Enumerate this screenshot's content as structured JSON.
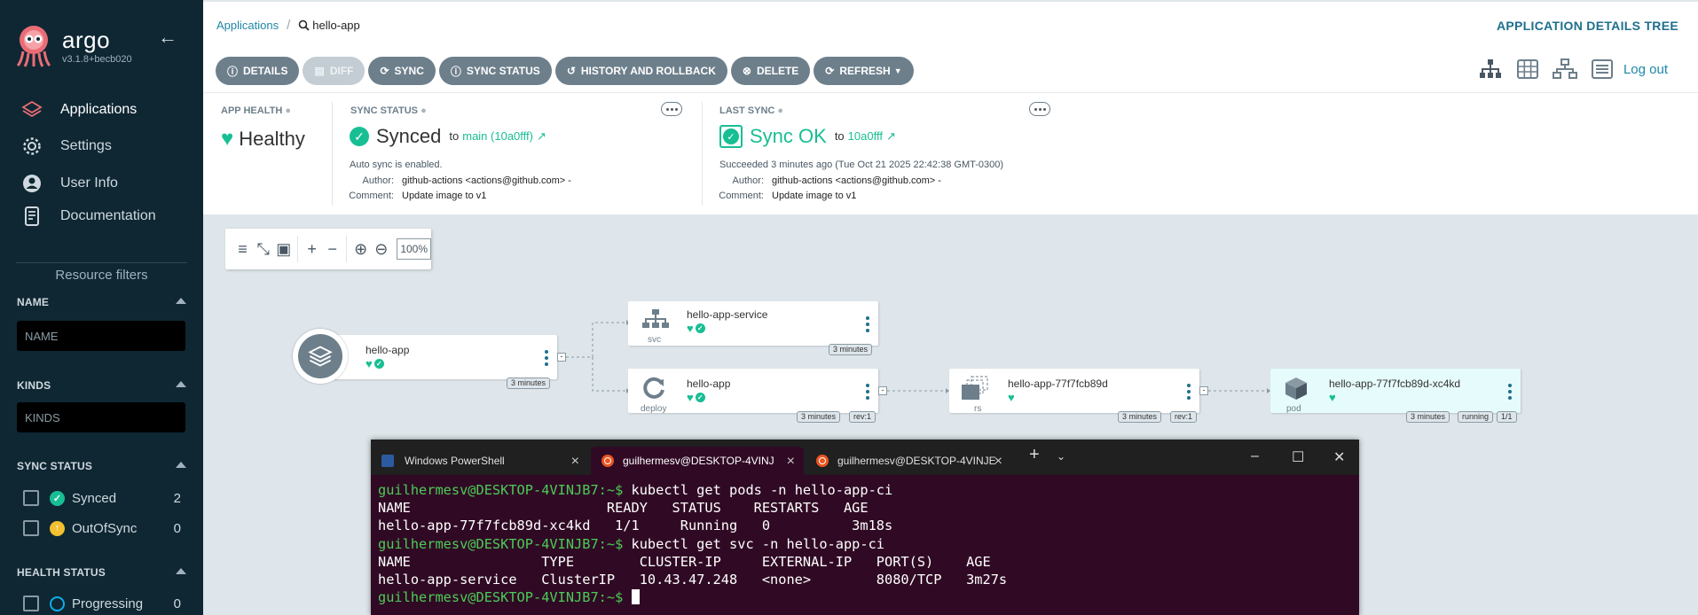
{
  "sidebar": {
    "logo_name": "argo",
    "version": "v3.1.8+becb020",
    "nav": [
      {
        "label": "Applications",
        "icon": "layers-icon"
      },
      {
        "label": "Settings",
        "icon": "gear-icon"
      },
      {
        "label": "User Info",
        "icon": "user-icon"
      },
      {
        "label": "Documentation",
        "icon": "docs-icon"
      }
    ],
    "resource_filters_label": "Resource filters",
    "filters": {
      "name_title": "NAME",
      "name_placeholder": "NAME",
      "kinds_title": "KINDS",
      "kinds_placeholder": "KINDS",
      "sync_status_title": "SYNC STATUS",
      "sync_status_options": [
        {
          "label": "Synced",
          "count": "2"
        },
        {
          "label": "OutOfSync",
          "count": "0"
        }
      ],
      "health_status_title": "HEALTH STATUS",
      "health_status_options": [
        {
          "label": "Progressing",
          "count": "0"
        }
      ]
    }
  },
  "header": {
    "breadcrumb_root": "Applications",
    "breadcrumb_current": "hello-app",
    "title": "APPLICATION DETAILS TREE",
    "logout": "Log out"
  },
  "toolbar": {
    "details": "DETAILS",
    "diff": "DIFF",
    "sync": "SYNC",
    "sync_status": "SYNC STATUS",
    "history": "HISTORY AND ROLLBACK",
    "delete": "DELETE",
    "refresh": "REFRESH"
  },
  "summary": {
    "app_health_label": "APP HEALTH",
    "health_value": "Healthy",
    "sync_status_label": "SYNC STATUS",
    "sync_value": "Synced",
    "sync_to": "to",
    "sync_revision": "main (10a0fff)",
    "auto_sync": "Auto sync is enabled.",
    "author_label": "Author:",
    "author_value": "github-actions <actions@github.com> -",
    "comment_label": "Comment:",
    "comment_value": "Update image to v1",
    "last_sync_label": "LAST SYNC",
    "last_sync_value": "Sync OK",
    "last_sync_to": "to",
    "last_sync_revision": "10a0fff",
    "succeeded": "Succeeded 3 minutes ago (Tue Oct 21 2025 22:42:38 GMT-0300)",
    "ls_author_label": "Author:",
    "ls_author_value": "github-actions <actions@github.com> -",
    "ls_comment_label": "Comment:",
    "ls_comment_value": "Update image to v1"
  },
  "graph": {
    "zoom": "100%",
    "nodes": {
      "root": {
        "name": "hello-app",
        "age": "3 minutes"
      },
      "svc": {
        "name": "hello-app-service",
        "kind": "svc",
        "age": "3 minutes"
      },
      "deploy": {
        "name": "hello-app",
        "kind": "deploy",
        "age": "3 minutes",
        "rev": "rev:1"
      },
      "rs": {
        "name": "hello-app-77f7fcb89d",
        "kind": "rs",
        "age": "3 minutes",
        "rev": "rev:1"
      },
      "pod": {
        "name": "hello-app-77f7fcb89d-xc4kd",
        "kind": "pod",
        "age": "3 minutes",
        "status": "running",
        "ready": "1/1"
      }
    }
  },
  "terminal": {
    "tabs": [
      {
        "label": "Windows PowerShell"
      },
      {
        "label": "guilhermesv@DESKTOP-4VINJ"
      },
      {
        "label": "guilhermesv@DESKTOP-4VINJE"
      }
    ],
    "prompt": "guilhermesv@DESKTOP-4VINJB7:~$",
    "lines": {
      "cmd1": " kubectl get pods -n hello-app-ci",
      "h1": "NAME                        READY   STATUS    RESTARTS   AGE",
      "r1": "hello-app-77f7fcb89d-xc4kd   1/1     Running   0          3m18s",
      "cmd2": " kubectl get svc -n hello-app-ci",
      "h2": "NAME                TYPE        CLUSTER-IP     EXTERNAL-IP   PORT(S)    AGE",
      "r2": "hello-app-service   ClusterIP   10.43.47.248   <none>        8080/TCP   3m27s"
    }
  },
  "colors": {
    "sidebar_bg": "#0f2733",
    "accent_green": "#18be94",
    "link_blue": "#1e87a7",
    "terminal_bg": "#300a24"
  }
}
